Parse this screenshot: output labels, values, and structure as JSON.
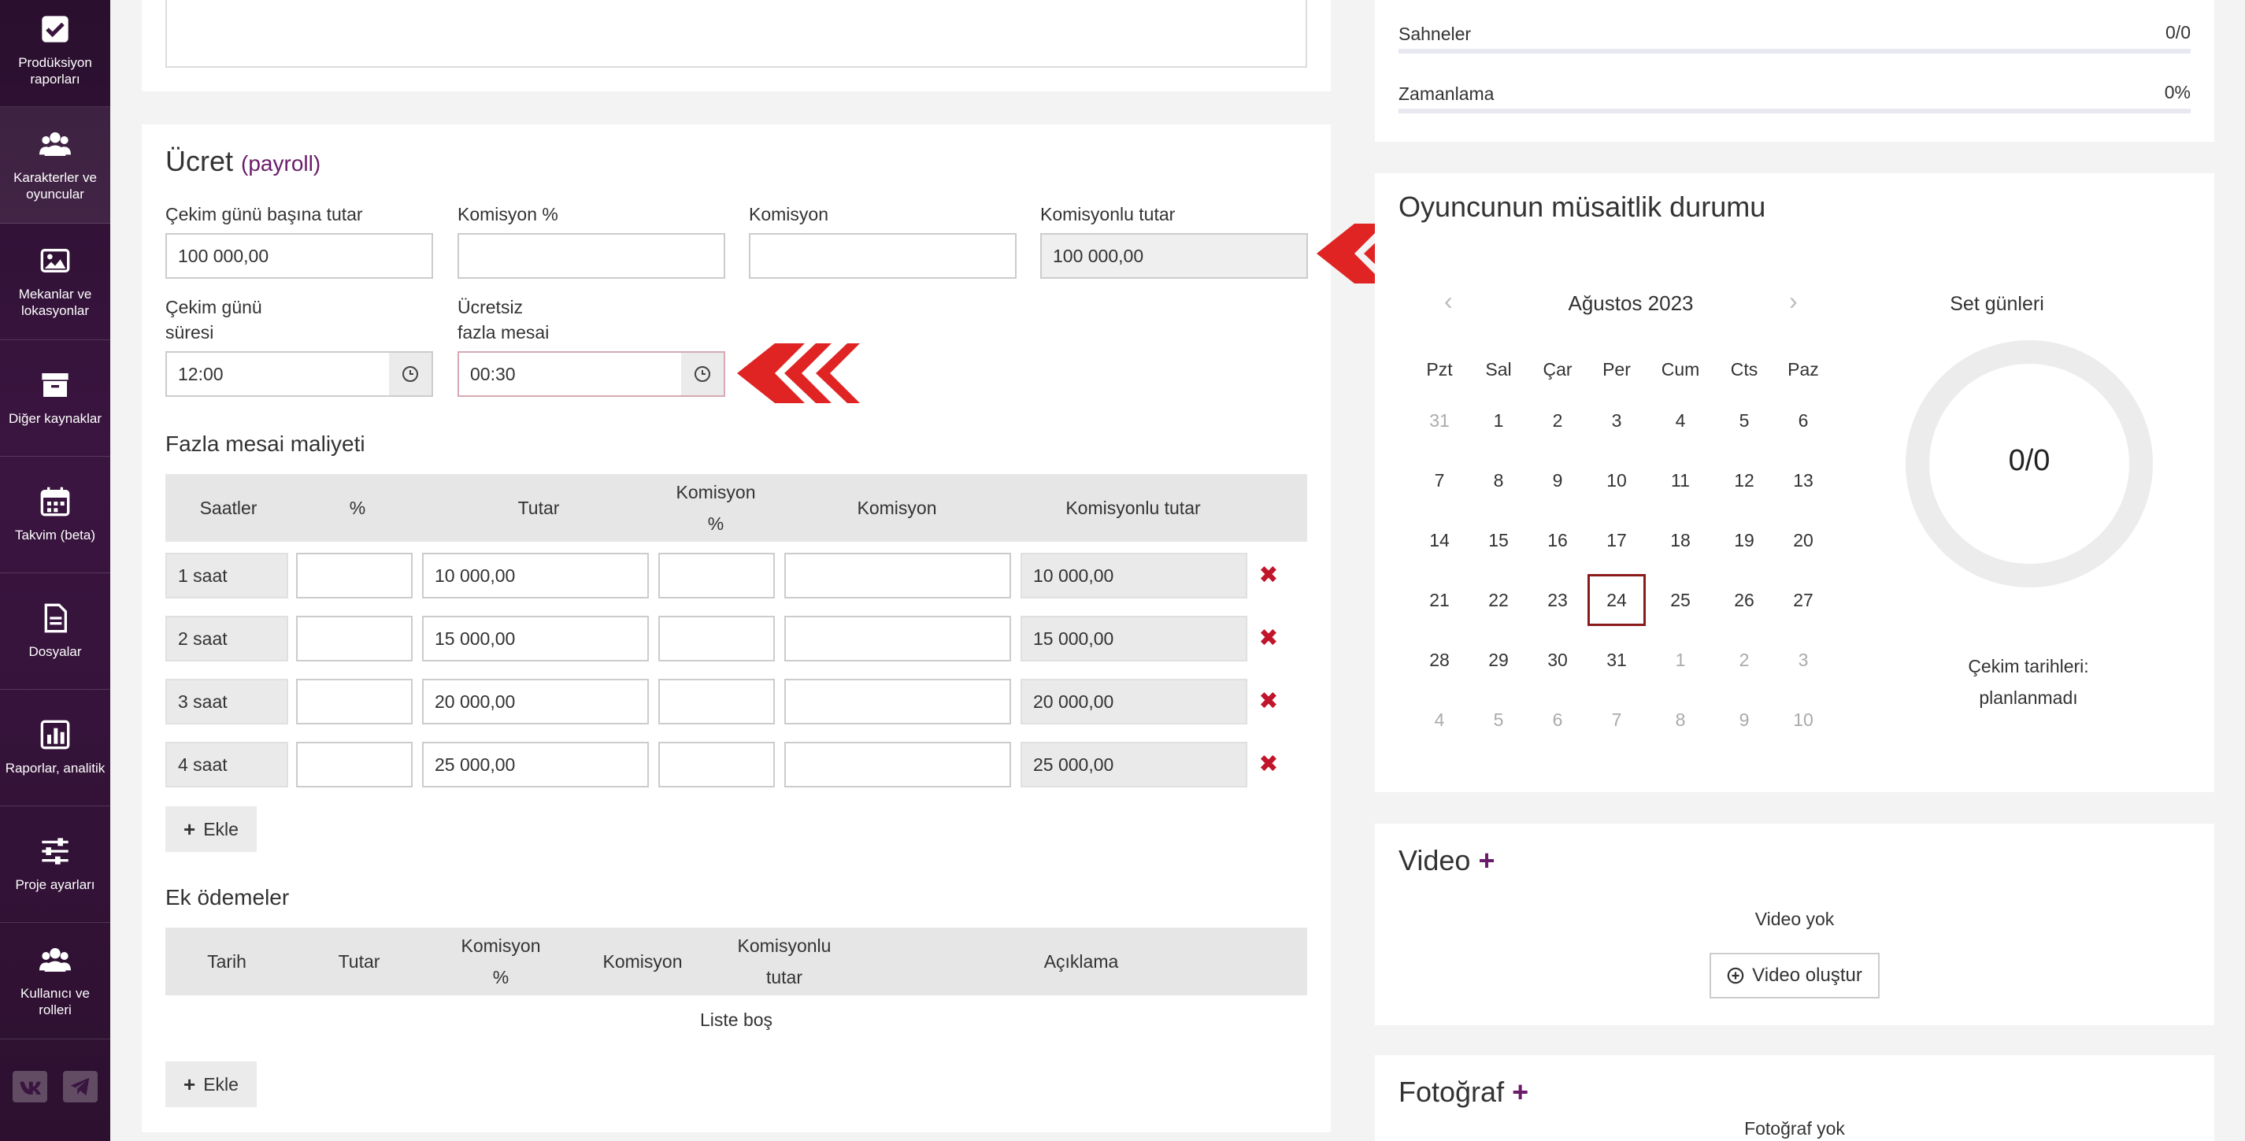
{
  "sidebar": {
    "items": [
      {
        "label": "Prodüksiyon raporları",
        "icon": "checkbox-icon"
      },
      {
        "label": "Karakterler ve oyuncular",
        "icon": "users-icon"
      },
      {
        "label": "Mekanlar ve lokasyonlar",
        "icon": "image-icon"
      },
      {
        "label": "Diğer kaynaklar",
        "icon": "archive-icon"
      },
      {
        "label": "Takvim (beta)",
        "icon": "calendar-icon"
      },
      {
        "label": "Dosyalar",
        "icon": "file-icon"
      },
      {
        "label": "Raporlar, analitik",
        "icon": "chart-icon"
      },
      {
        "label": "Proje ayarları",
        "icon": "sliders-icon"
      },
      {
        "label": "Kullanıcı ve rolleri",
        "icon": "users-icon"
      }
    ]
  },
  "payroll": {
    "title": "Ücret",
    "subtitle": "(payroll)",
    "day_rate_label": "Çekim günü başına tutar",
    "day_rate_value": "100 000,00",
    "commission_pct_label": "Komisyon %",
    "commission_pct_value": "",
    "commission_label": "Komisyon",
    "commission_value": "",
    "with_commission_label": "Komisyonlu tutar",
    "with_commission_value": "100 000,00",
    "day_length_label_1": "Çekim günü",
    "day_length_label_2": "süresi",
    "day_length_value": "12:00",
    "free_overtime_label_1": "Ücretsiz",
    "free_overtime_label_2": "fazla mesai",
    "free_overtime_value": "00:30"
  },
  "overtime": {
    "title": "Fazla mesai maliyeti",
    "headers": {
      "hours": "Saatler",
      "pct": "%",
      "amount": "Tutar",
      "commission_pct_1": "Komisyon",
      "commission_pct_2": "%",
      "commission": "Komisyon",
      "with_commission": "Komisyonlu tutar"
    },
    "rows": [
      {
        "hours": "1 saat",
        "pct": "",
        "amount": "10 000,00",
        "comm_pct": "",
        "comm": "",
        "total": "10 000,00"
      },
      {
        "hours": "2 saat",
        "pct": "",
        "amount": "15 000,00",
        "comm_pct": "",
        "comm": "",
        "total": "15 000,00"
      },
      {
        "hours": "3 saat",
        "pct": "",
        "amount": "20 000,00",
        "comm_pct": "",
        "comm": "",
        "total": "20 000,00"
      },
      {
        "hours": "4 saat",
        "pct": "",
        "amount": "25 000,00",
        "comm_pct": "",
        "comm": "",
        "total": "25 000,00"
      }
    ],
    "add_label": "Ekle"
  },
  "extra": {
    "title": "Ek ödemeler",
    "headers": {
      "date": "Tarih",
      "amount": "Tutar",
      "comm_pct_1": "Komisyon",
      "comm_pct_2": "%",
      "comm": "Komisyon",
      "with_comm_1": "Komisyonlu",
      "with_comm_2": "tutar",
      "desc": "Açıklama"
    },
    "empty": "Liste boş",
    "add_label": "Ekle"
  },
  "stats": {
    "scenes_label": "Sahneler",
    "scenes_value": "0/0",
    "timing_label": "Zamanlama",
    "timing_value": "0%"
  },
  "availability": {
    "title": "Oyuncunun müsaitlik durumu",
    "month": "Ağustos 2023",
    "prev": "‹",
    "next": "›",
    "dow": [
      "Pzt",
      "Sal",
      "Çar",
      "Per",
      "Cum",
      "Cts",
      "Paz"
    ],
    "weeks": [
      [
        {
          "d": "31",
          "m": true
        },
        {
          "d": "1"
        },
        {
          "d": "2"
        },
        {
          "d": "3"
        },
        {
          "d": "4"
        },
        {
          "d": "5"
        },
        {
          "d": "6"
        }
      ],
      [
        {
          "d": "7"
        },
        {
          "d": "8"
        },
        {
          "d": "9"
        },
        {
          "d": "10"
        },
        {
          "d": "11"
        },
        {
          "d": "12"
        },
        {
          "d": "13"
        }
      ],
      [
        {
          "d": "14"
        },
        {
          "d": "15"
        },
        {
          "d": "16"
        },
        {
          "d": "17"
        },
        {
          "d": "18"
        },
        {
          "d": "19"
        },
        {
          "d": "20"
        }
      ],
      [
        {
          "d": "21"
        },
        {
          "d": "22"
        },
        {
          "d": "23"
        },
        {
          "d": "24",
          "t": true
        },
        {
          "d": "25"
        },
        {
          "d": "26"
        },
        {
          "d": "27"
        }
      ],
      [
        {
          "d": "28"
        },
        {
          "d": "29"
        },
        {
          "d": "30"
        },
        {
          "d": "31"
        },
        {
          "d": "1",
          "m": true
        },
        {
          "d": "2",
          "m": true
        },
        {
          "d": "3",
          "m": true
        }
      ],
      [
        {
          "d": "4",
          "m": true
        },
        {
          "d": "5",
          "m": true
        },
        {
          "d": "6",
          "m": true
        },
        {
          "d": "7",
          "m": true
        },
        {
          "d": "8",
          "m": true
        },
        {
          "d": "9",
          "m": true
        },
        {
          "d": "10",
          "m": true
        }
      ]
    ],
    "set_days_label": "Set günleri",
    "set_days_value": "0/0",
    "set_days_progress": 0,
    "dates_label": "Çekim tarihleri:",
    "dates_value": "planlanmadı"
  },
  "video": {
    "title": "Video",
    "plus": "+",
    "empty": "Video yok",
    "create_label": "Video oluştur"
  },
  "photo": {
    "title": "Fotoğraf",
    "plus": "+",
    "empty": "Fotoğraf yok"
  },
  "colors": {
    "sidebar": "#3a1540",
    "accent": "#6a1b6a",
    "arrow": "#e02424",
    "delete": "#c0152b",
    "today_border": "#8b1a1a"
  }
}
